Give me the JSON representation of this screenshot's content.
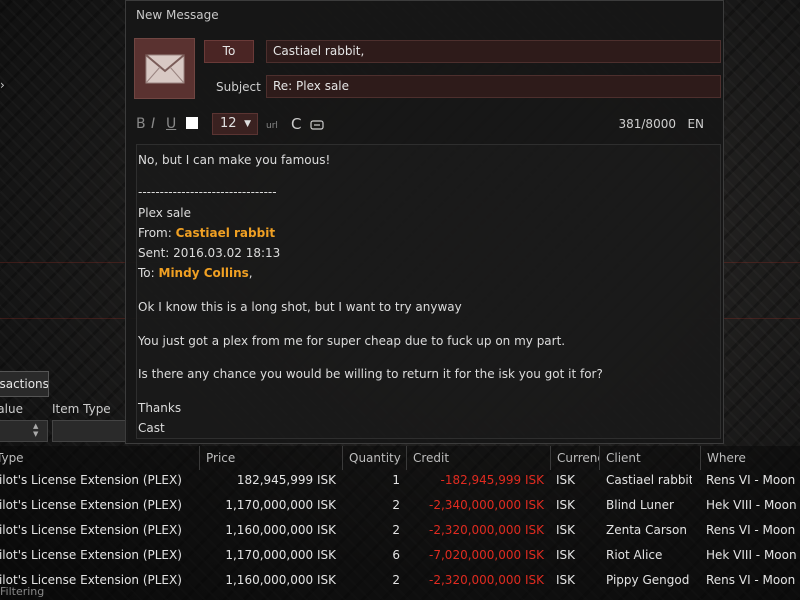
{
  "dialog": {
    "title": "New Message",
    "to_label": "To",
    "to_value": "Castiael rabbit,",
    "subject_label": "Subject",
    "subject_value": "Re: Plex sale",
    "toolbar": {
      "bold": "B",
      "italic": "I",
      "underline": "U",
      "font_size": "12",
      "url": "url",
      "clear": "C",
      "char_count": "381/8000",
      "language": "EN"
    },
    "body": {
      "line1": "No, but I can make you famous!",
      "separator": "--------------------------------",
      "quoted_subject": "Plex sale",
      "from_label": "From: ",
      "from_name": "Castiael rabbit",
      "sent": "Sent: 2016.03.02 18:13",
      "to_label": "To: ",
      "to_name": "Mindy Collins",
      "to_suffix": ",",
      "para1": "Ok I know this is a long shot, but I want to try anyway",
      "para2": "You just got a plex from me for super cheap due to fuck up on my part.",
      "para3": "Is there any chance you would be willing to return it for the isk you got it for?",
      "sign1": "Thanks",
      "sign2": "Cast"
    }
  },
  "left_panel": {
    "tab_label": "Transactions",
    "col_value": "Value",
    "col_item_type": "Item Type"
  },
  "table": {
    "headers": {
      "type": "Type",
      "price": "Price",
      "quantity": "Quantity",
      "credit": "Credit",
      "currency": "Currency",
      "client": "Client",
      "where": "Where"
    },
    "rows": [
      {
        "type": "Pilot's License Extension (PLEX)",
        "price": "182,945,999 ISK",
        "quantity": "1",
        "credit": "-182,945,999 ISK",
        "currency": "ISK",
        "client": "Castiael rabbit",
        "where": "Rens VI - Moon"
      },
      {
        "type": "Pilot's License Extension (PLEX)",
        "price": "1,170,000,000 ISK",
        "quantity": "2",
        "credit": "-2,340,000,000 ISK",
        "currency": "ISK",
        "client": "Blind Luner",
        "where": "Hek VIII - Moon"
      },
      {
        "type": "Pilot's License Extension (PLEX)",
        "price": "1,160,000,000 ISK",
        "quantity": "2",
        "credit": "-2,320,000,000 ISK",
        "currency": "ISK",
        "client": "Zenta Carson",
        "where": "Rens VI - Moon"
      },
      {
        "type": "Pilot's License Extension (PLEX)",
        "price": "1,170,000,000 ISK",
        "quantity": "6",
        "credit": "-7,020,000,000 ISK",
        "currency": "ISK",
        "client": "Riot Alice",
        "where": "Hek VIII - Moon"
      },
      {
        "type": "Pilot's License Extension (PLEX)",
        "price": "1,160,000,000 ISK",
        "quantity": "2",
        "credit": "-2,320,000,000 ISK",
        "currency": "ISK",
        "client": "Pippy Gengod",
        "where": "Rens VI - Moon"
      }
    ],
    "footer": "Filtering"
  },
  "colors": {
    "highlight": "#f0a023",
    "negative": "#e02b20",
    "field_bg": "#2e1b1a"
  }
}
